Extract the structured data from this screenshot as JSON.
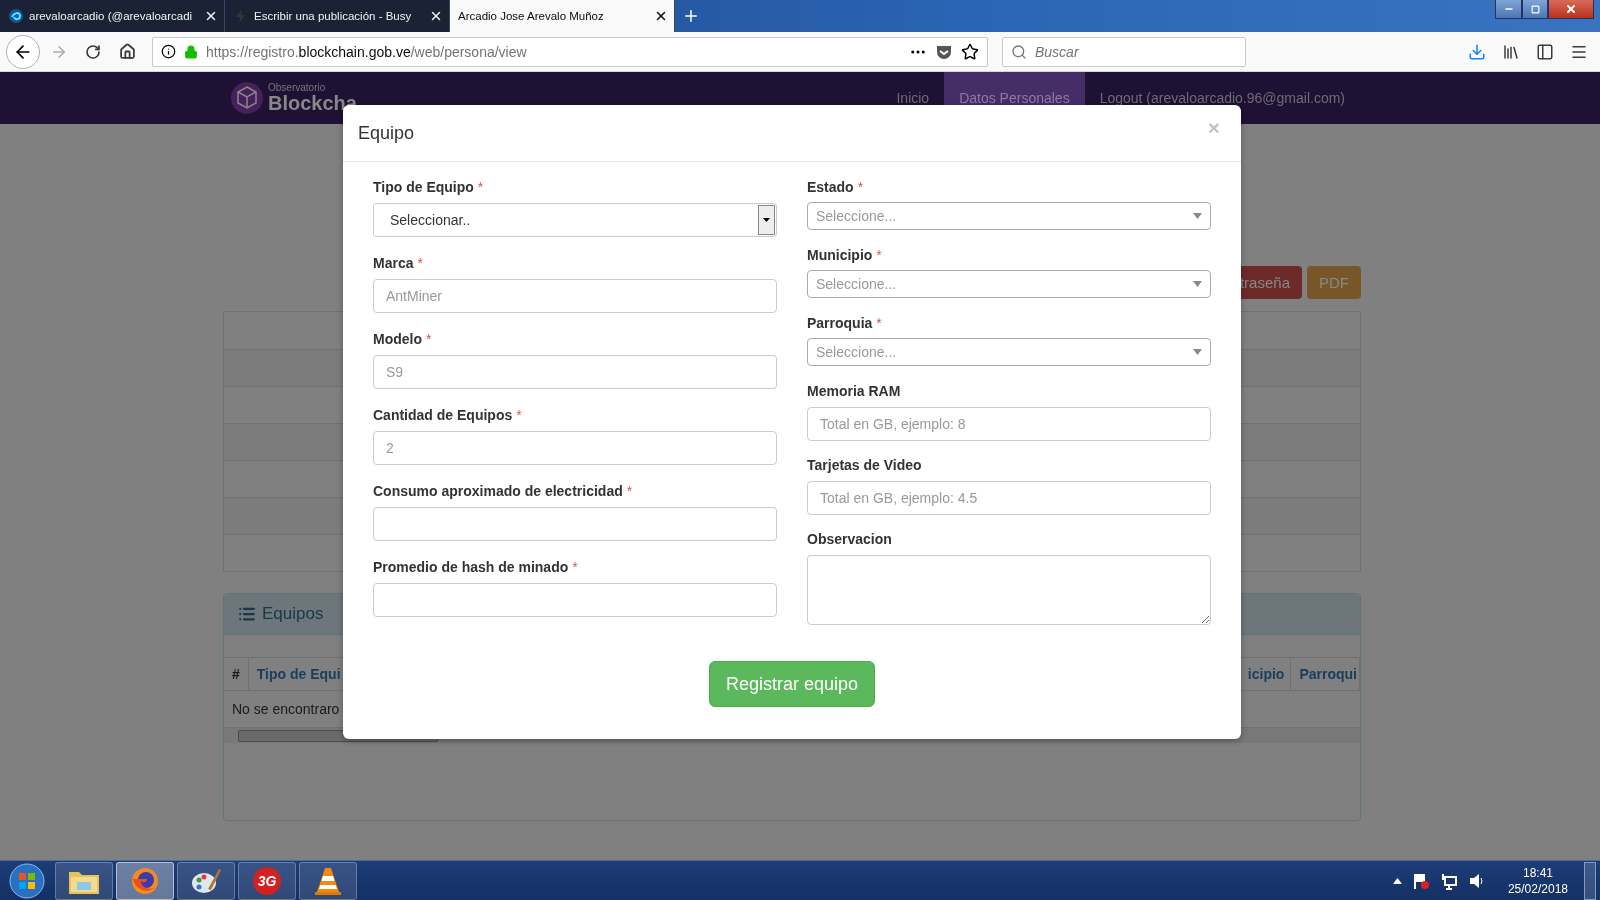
{
  "browser": {
    "tabs": [
      {
        "title": "arevaloarcadio (@arevaloarcadi",
        "selected": false
      },
      {
        "title": "Escribir una publicación - Busy",
        "selected": false
      },
      {
        "title": "Arcadio Jose Arevalo Muñoz",
        "selected": true
      }
    ],
    "address": {
      "prefix": "https://registro.",
      "domain": "blockchain.gob.ve",
      "path": "/web/persona/view"
    },
    "search": {
      "placeholder": "Buscar"
    }
  },
  "page": {
    "brand": {
      "caption": "Observatorio",
      "name": "Blockcha"
    },
    "nav": [
      {
        "label": "Inicio",
        "selected": false
      },
      {
        "label": "Datos Personales",
        "selected": true
      },
      {
        "label": "Logout (arevaloarcadio.96@gmail.com)",
        "selected": false
      }
    ],
    "actions": [
      {
        "label": "traseña",
        "color": "#6c2a28"
      },
      {
        "label": "PDF",
        "color": "#785627"
      }
    ],
    "equipos": {
      "title": "Equipos",
      "columns_left": [
        "#",
        "Tipo de Equi"
      ],
      "columns_right": [
        "icipio",
        "Parroqui"
      ],
      "empty_message": "No se encontraro"
    }
  },
  "modal": {
    "title": "Equipo",
    "close": "×",
    "left_fields": [
      {
        "label": "Tipo de Equipo",
        "required_mark": "*",
        "kind": "native-select",
        "value": "Seleccionar.."
      },
      {
        "label": "Marca",
        "required_mark": "*",
        "kind": "input",
        "placeholder": "AntMiner"
      },
      {
        "label": "Modelo",
        "required_mark": "*",
        "kind": "input",
        "placeholder": "S9"
      },
      {
        "label": "Cantidad de Equipos",
        "required_mark": "*",
        "kind": "input",
        "placeholder": "2"
      },
      {
        "label": "Consumo aproximado de electricidad",
        "required_mark": "*",
        "kind": "input"
      },
      {
        "label": "Promedio de hash de minado",
        "required_mark": "*",
        "kind": "input"
      }
    ],
    "right_fields": [
      {
        "label": "Estado",
        "required_mark": "*",
        "kind": "select",
        "placeholder": "Seleccione..."
      },
      {
        "label": "Municipio",
        "required_mark": "*",
        "kind": "select",
        "placeholder": "Seleccione..."
      },
      {
        "label": "Parroquia",
        "required_mark": "*",
        "kind": "select",
        "placeholder": "Seleccione..."
      },
      {
        "label": "Memoria RAM",
        "kind": "input",
        "placeholder": "Total en GB, ejemplo: 8"
      },
      {
        "label": "Tarjetas de Video",
        "kind": "input",
        "placeholder": "Total en GB, ejemplo: 4.5"
      },
      {
        "label": "Observacion",
        "kind": "textarea"
      }
    ],
    "submit": "Registrar equipo"
  },
  "taskbar": {
    "apps": [
      {
        "kind": "folder",
        "selected": false
      },
      {
        "kind": "firefox",
        "selected": true
      },
      {
        "kind": "paint",
        "selected": false
      },
      {
        "kind": "badge",
        "label": "3G",
        "selected": false
      },
      {
        "kind": "cone",
        "selected": false
      }
    ],
    "time": "18:41",
    "date": "25/02/2018"
  }
}
